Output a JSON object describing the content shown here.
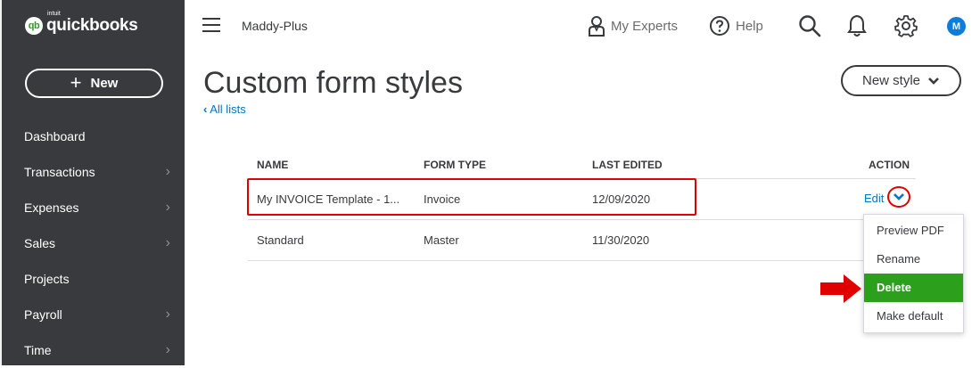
{
  "sidebar": {
    "logo_intuit": "intuit",
    "logo_word": "quickbooks",
    "logo_mark": "qb",
    "new_label": "New",
    "items": [
      {
        "label": "Dashboard",
        "chevron": false
      },
      {
        "label": "Transactions",
        "chevron": true
      },
      {
        "label": "Expenses",
        "chevron": true
      },
      {
        "label": "Sales",
        "chevron": true
      },
      {
        "label": "Projects",
        "chevron": false
      },
      {
        "label": "Payroll",
        "chevron": true
      },
      {
        "label": "Time",
        "chevron": true
      }
    ]
  },
  "topbar": {
    "company": "Maddy-Plus",
    "my_experts": "My Experts",
    "help": "Help",
    "avatar_initial": "M"
  },
  "page": {
    "title": "Custom form styles",
    "back_link": "All lists",
    "new_style": "New style"
  },
  "table": {
    "headers": {
      "name": "NAME",
      "form_type": "FORM TYPE",
      "last_edited": "LAST EDITED",
      "action": "ACTION"
    },
    "rows": [
      {
        "name": "My INVOICE Template - 1...",
        "form_type": "Invoice",
        "last_edited": "12/09/2020",
        "action": "Edit"
      },
      {
        "name": "Standard",
        "form_type": "Master",
        "last_edited": "11/30/2020",
        "action": ""
      }
    ]
  },
  "menu": {
    "items": [
      "Preview PDF",
      "Rename",
      "Delete",
      "Make default"
    ],
    "active_index": 2
  },
  "colors": {
    "sidebar_bg": "#393a3d",
    "brand_green": "#2ca01c",
    "link_blue": "#0077c5",
    "annotation_red": "#e10000"
  },
  "icons": [
    "hamburger-icon",
    "person-icon",
    "help-icon",
    "search-icon",
    "bell-icon",
    "gear-icon",
    "chevron-down-icon",
    "chevron-left-icon",
    "chevron-right-icon",
    "plus-icon",
    "red-arrow-icon"
  ]
}
